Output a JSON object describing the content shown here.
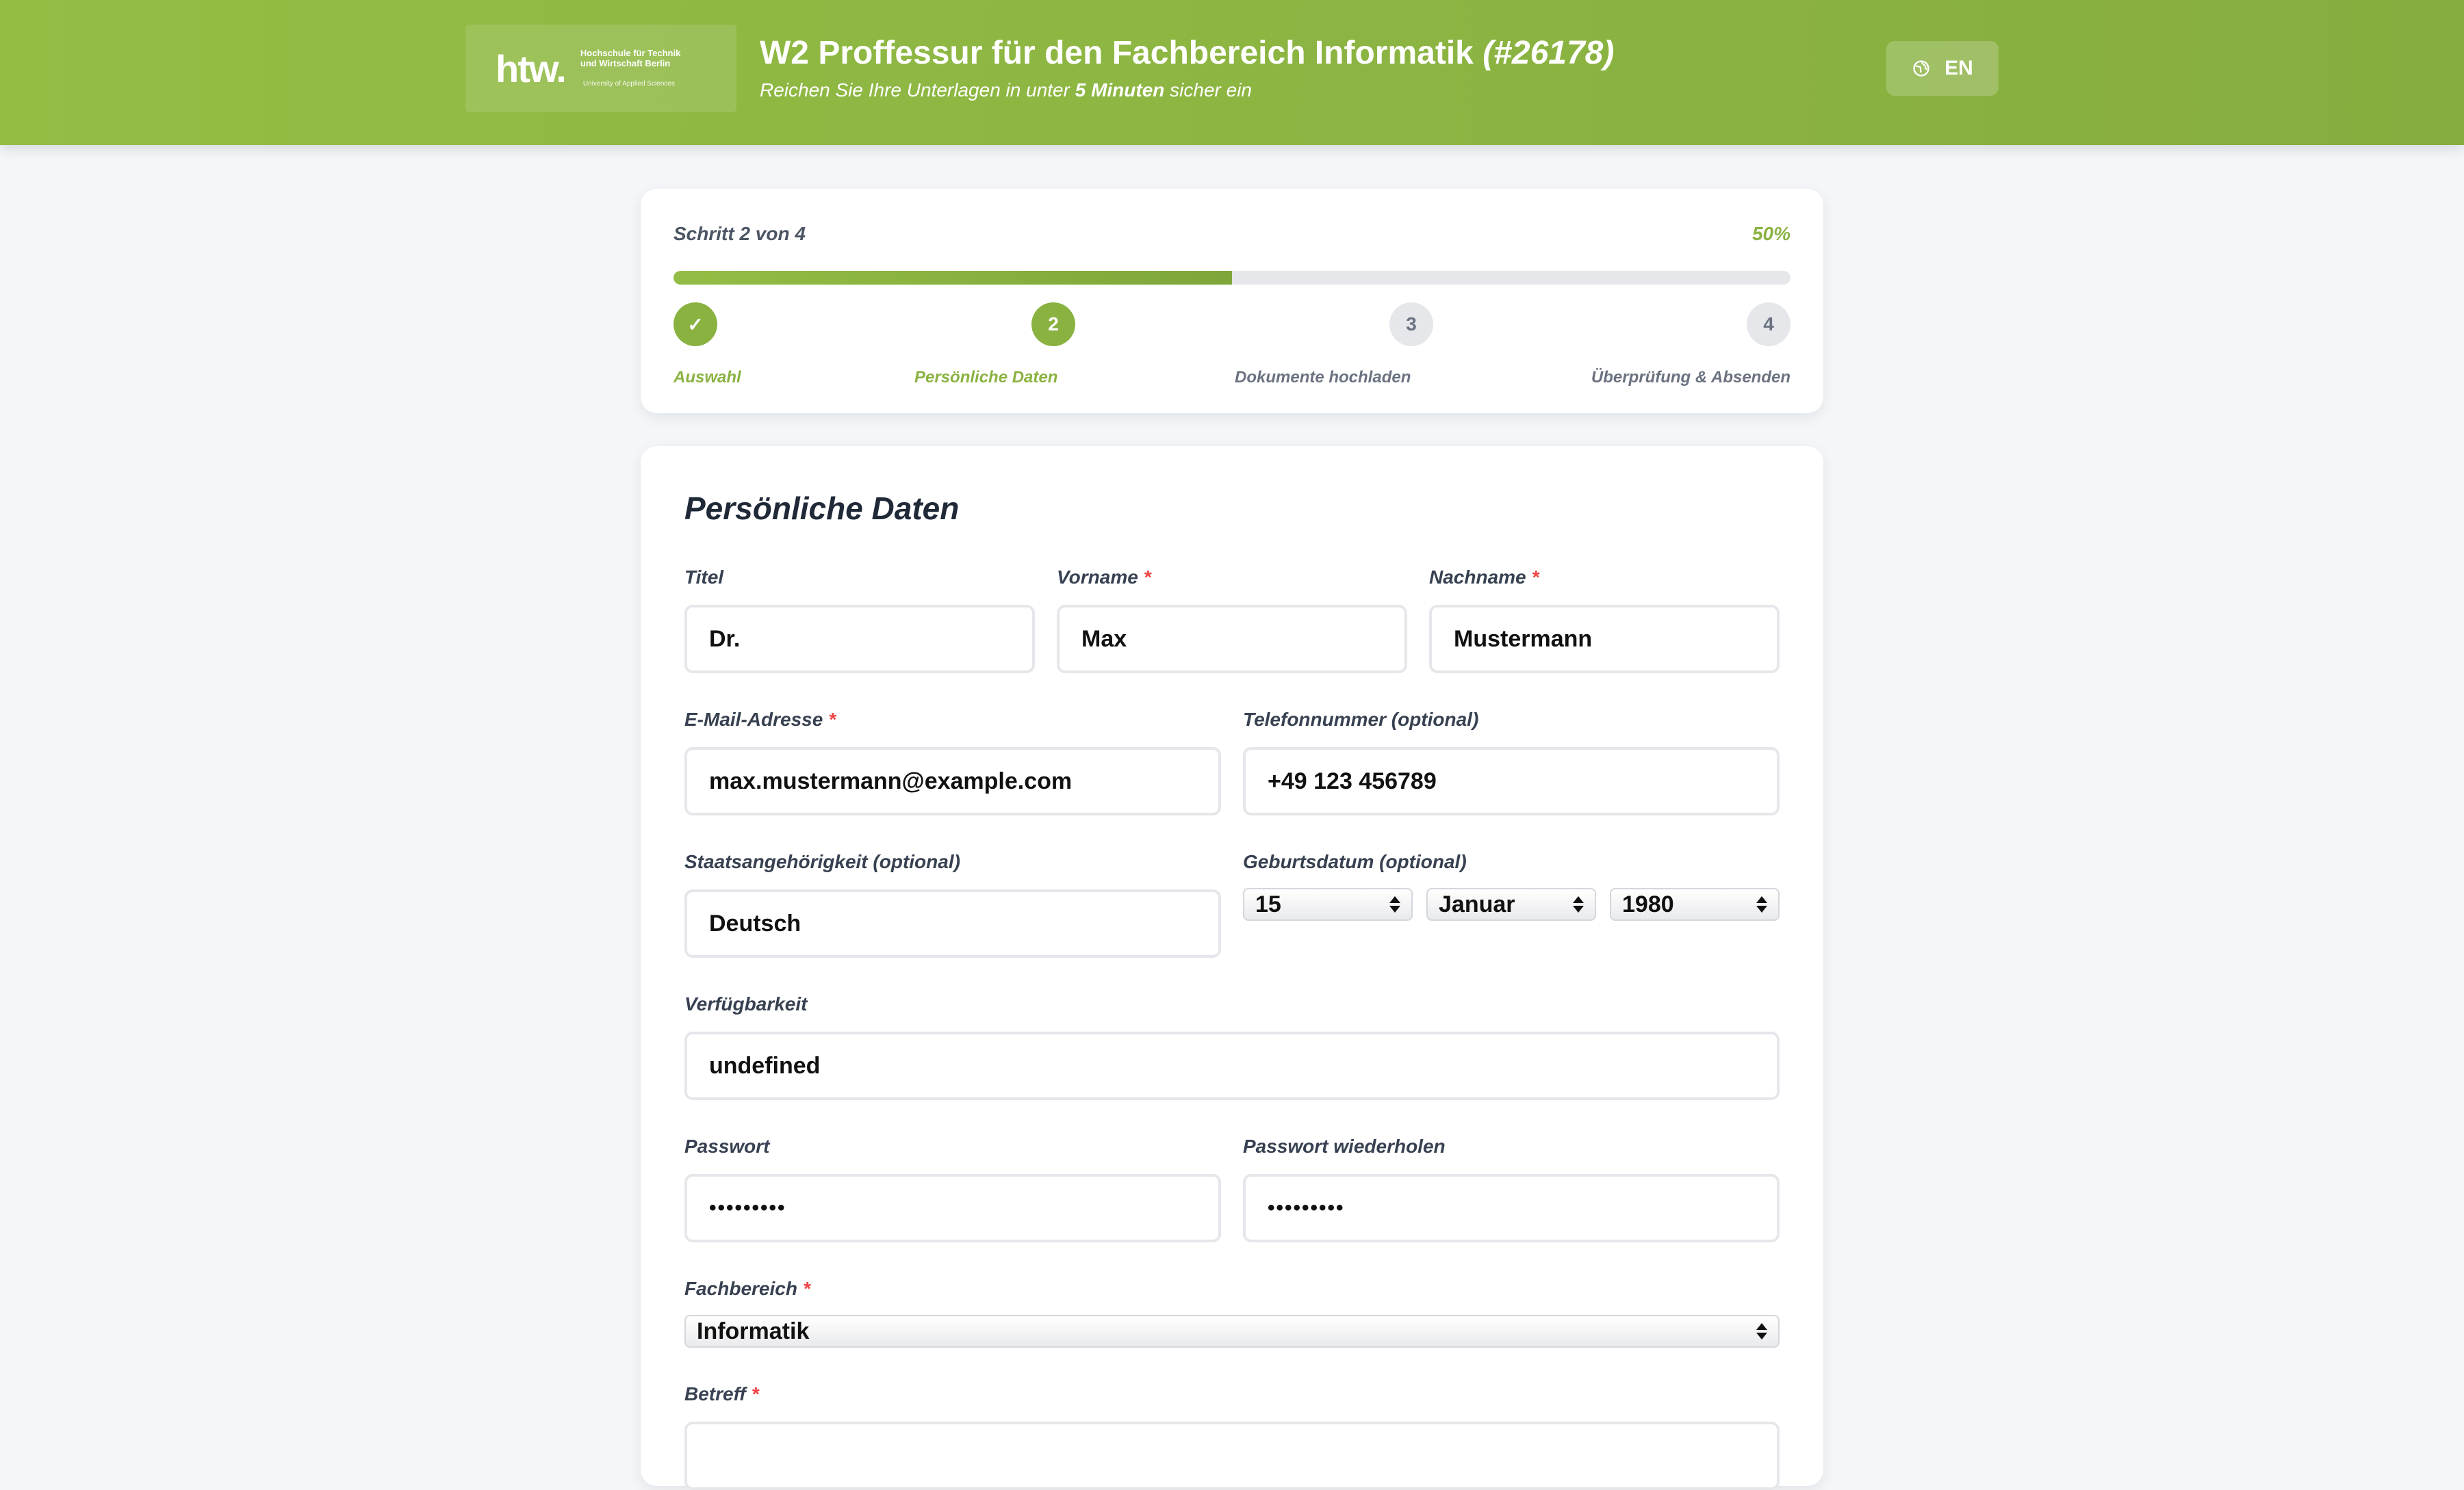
{
  "header": {
    "logo_mark": "htw.",
    "logo_line1": "Hochschule für Technik",
    "logo_line2": "und Wirtschaft Berlin",
    "logo_sub": "University of Applied Sciences",
    "title": "W2 Proffessur für den Fachbereich Informatik",
    "code": "(#26178)",
    "sub_prefix": "Reichen Sie Ihre Unterlagen in unter",
    "sub_bold": "5 Minuten",
    "sub_suffix": "sicher ein",
    "lang_label": "EN"
  },
  "progress": {
    "step_text": "Schritt 2 von 4",
    "percent_text": "50%",
    "fill_fraction": 0.5,
    "steps": [
      {
        "number": "✓",
        "label": "Auswahl",
        "state": "done"
      },
      {
        "number": "2",
        "label": "Persönliche Daten",
        "state": "active"
      },
      {
        "number": "3",
        "label": "Dokumente hochladen",
        "state": "todo"
      },
      {
        "number": "4",
        "label": "Überprüfung & Absenden",
        "state": "todo"
      }
    ]
  },
  "form": {
    "section_title": "Persönliche Daten",
    "required_mark": "*",
    "titel": {
      "label": "Titel",
      "value": "Dr."
    },
    "vorname": {
      "label": "Vorname",
      "value": "Max"
    },
    "nachname": {
      "label": "Nachname",
      "value": "Mustermann"
    },
    "email": {
      "label": "E-Mail-Adresse",
      "value": "max.mustermann@example.com"
    },
    "telefon": {
      "label": "Telefonnummer (optional)",
      "value": "+49 123 456789"
    },
    "staat": {
      "label": "Staatsangehörigkeit (optional)",
      "value": "Deutsch"
    },
    "geburt": {
      "label": "Geburtsdatum (optional)",
      "day": "15",
      "month": "Januar",
      "year": "1980"
    },
    "verfuegbarkeit": {
      "label": "Verfügbarkeit",
      "value": "undefined"
    },
    "passwort": {
      "label": "Passwort",
      "value": "•••••••••"
    },
    "passwort2": {
      "label": "Passwort wiederholen",
      "value": "•••••••••"
    },
    "fachbereich": {
      "label": "Fachbereich",
      "value": "Informatik"
    },
    "betreff": {
      "label": "Betreff"
    }
  }
}
